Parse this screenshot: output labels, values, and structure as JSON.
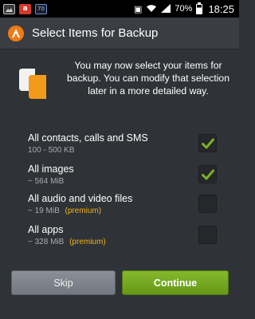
{
  "status_bar": {
    "icons_left": [
      "gallery-icon",
      "avast-icon",
      "calendar-icon"
    ],
    "calendar_day": "70",
    "battery": "70%",
    "time": "18:25"
  },
  "header": {
    "title": "Select Items for Backup"
  },
  "intro": {
    "text": "You may now select your items for backup. You can modify that selection later in a more detailed way."
  },
  "items": [
    {
      "title": "All contacts, calls and SMS",
      "size": "100 - 500 KB",
      "premium": "",
      "checked": true
    },
    {
      "title": "All images",
      "size": "~ 564 MiB",
      "premium": "",
      "checked": true
    },
    {
      "title": "All audio and video files",
      "size": "~ 19 MiB",
      "premium": "(premium)",
      "checked": false
    },
    {
      "title": "All apps",
      "size": "~ 328 MiB",
      "premium": "(premium)",
      "checked": false
    }
  ],
  "buttons": {
    "skip": "Skip",
    "continue": "Continue"
  },
  "colors": {
    "accent_green": "#7ab028",
    "premium": "#f2b21b",
    "background": "#2f3236"
  }
}
